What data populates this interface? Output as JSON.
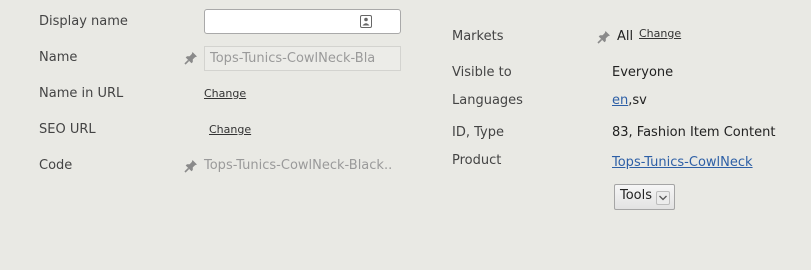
{
  "left": {
    "display_name": {
      "label": "Display name",
      "value": ""
    },
    "name": {
      "label": "Name",
      "value": "Tops-Tunics-CowlNeck-Bla"
    },
    "name_in_url": {
      "label": "Name in URL",
      "action": "Change"
    },
    "seo_url": {
      "label": "SEO URL",
      "action": "Change"
    },
    "code": {
      "label": "Code",
      "value": "Tops-Tunics-CowlNeck-Black.."
    }
  },
  "right": {
    "markets": {
      "label": "Markets",
      "value": "All",
      "action": "Change"
    },
    "visible_to": {
      "label": "Visible to",
      "value": "Everyone"
    },
    "languages": {
      "label": "Languages",
      "link": "en",
      "rest": ",sv"
    },
    "id_type": {
      "label": "ID, Type",
      "value": "83, Fashion Item Content"
    },
    "product": {
      "label": "Product",
      "link": "Tops-Tunics-CowlNeck"
    },
    "tools": {
      "label": "Tools"
    }
  },
  "icons": {
    "pin": "pin-icon",
    "contact": "contact-card-icon",
    "chevron": "chevron-down-icon"
  }
}
